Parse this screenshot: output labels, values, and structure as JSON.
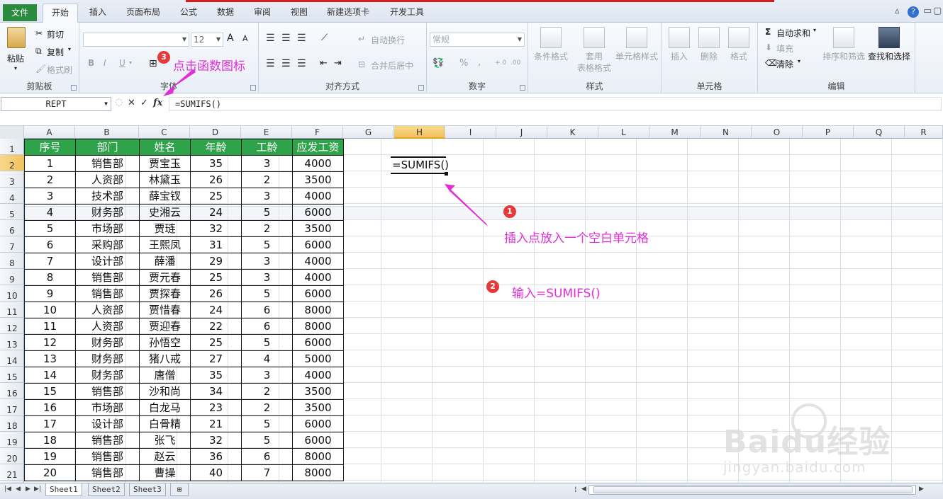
{
  "ribbon": {
    "tabs": [
      "文件",
      "开始",
      "插入",
      "页面布局",
      "公式",
      "数据",
      "审阅",
      "视图",
      "新建选项卡",
      "开发工具"
    ],
    "active_tab": "开始",
    "clipboard": {
      "paste": "粘贴",
      "cut": "剪切",
      "copy": "复制",
      "format_painter": "格式刷",
      "label": "剪贴板"
    },
    "font": {
      "size": "12",
      "bold": "B",
      "italic": "I",
      "underline": "U",
      "grow": "A",
      "shrink": "A",
      "label": "字体"
    },
    "alignment": {
      "wrap": "自动换行",
      "merge": "合并后居中",
      "label": "对齐方式"
    },
    "number": {
      "format": "常规",
      "percent": "%",
      "comma": ",",
      "label": "数字"
    },
    "styles": {
      "conditional": "条件格式",
      "table_format": "套用\n表格格式",
      "cell_styles": "单元格样式",
      "label": "样式"
    },
    "cells": {
      "insert": "插入",
      "delete": "删除",
      "format": "格式",
      "label": "单元格"
    },
    "editing": {
      "autosum": "自动求和",
      "fill": "填充",
      "clear": "清除",
      "sort": "排序和筛选",
      "find": "查找和选择",
      "label": "编辑"
    }
  },
  "formula_bar": {
    "name_box": "REPT",
    "cancel": "✕",
    "enter": "✓",
    "fx": "fx",
    "formula": "=SUMIFS()"
  },
  "grid": {
    "columns": [
      "A",
      "B",
      "C",
      "D",
      "E",
      "F",
      "G",
      "H",
      "I",
      "J",
      "K",
      "L",
      "M",
      "N",
      "O",
      "P",
      "Q",
      "R"
    ],
    "selected_column": "H",
    "rows": [
      "1",
      "2",
      "3",
      "4",
      "5",
      "6",
      "7",
      "8",
      "9",
      "10",
      "11",
      "12",
      "13",
      "14",
      "15",
      "16",
      "17",
      "18",
      "19",
      "20",
      "21"
    ],
    "selected_row": "2",
    "active_cell_value": "=SUMIFS()"
  },
  "table": {
    "headers": [
      "序号",
      "部门",
      "姓名",
      "年龄",
      "工龄",
      "应发工资"
    ],
    "rows": [
      [
        "1",
        "销售部",
        "贾宝玉",
        "35",
        "3",
        "4000"
      ],
      [
        "2",
        "人资部",
        "林黛玉",
        "26",
        "2",
        "3500"
      ],
      [
        "3",
        "技术部",
        "薛宝钗",
        "25",
        "3",
        "4000"
      ],
      [
        "4",
        "财务部",
        "史湘云",
        "24",
        "5",
        "6000"
      ],
      [
        "5",
        "市场部",
        "贾琏",
        "32",
        "2",
        "3500"
      ],
      [
        "6",
        "采购部",
        "王熙凤",
        "31",
        "5",
        "6000"
      ],
      [
        "7",
        "设计部",
        "薛潘",
        "29",
        "3",
        "4000"
      ],
      [
        "8",
        "销售部",
        "贾元春",
        "25",
        "3",
        "4000"
      ],
      [
        "9",
        "销售部",
        "贾探春",
        "26",
        "5",
        "6000"
      ],
      [
        "10",
        "人资部",
        "贾惜春",
        "24",
        "6",
        "8000"
      ],
      [
        "11",
        "人资部",
        "贾迎春",
        "22",
        "6",
        "8000"
      ],
      [
        "12",
        "财务部",
        "孙悟空",
        "25",
        "5",
        "6000"
      ],
      [
        "13",
        "财务部",
        "猪八戒",
        "27",
        "4",
        "5000"
      ],
      [
        "14",
        "财务部",
        "唐僧",
        "35",
        "3",
        "4000"
      ],
      [
        "15",
        "销售部",
        "沙和尚",
        "34",
        "2",
        "3500"
      ],
      [
        "16",
        "市场部",
        "白龙马",
        "23",
        "2",
        "3500"
      ],
      [
        "17",
        "设计部",
        "白骨精",
        "21",
        "5",
        "6000"
      ],
      [
        "18",
        "销售部",
        "张飞",
        "32",
        "5",
        "6000"
      ],
      [
        "19",
        "销售部",
        "赵云",
        "36",
        "6",
        "8000"
      ],
      [
        "20",
        "销售部",
        "曹操",
        "40",
        "7",
        "8000"
      ]
    ]
  },
  "annotations": {
    "step1": {
      "num": "1",
      "text": "插入点放入一个空白单元格"
    },
    "step2": {
      "num": "2",
      "text": "输入=SUMIFS()"
    },
    "step3": {
      "num": "3",
      "text": "点击函数图标"
    }
  },
  "sheets": [
    "Sheet1",
    "Sheet2",
    "Sheet3"
  ],
  "active_sheet": "Sheet1",
  "watermark": {
    "brand": "Baidu经验",
    "url": "jingyan.baidu.com"
  },
  "colors": {
    "header_fill": "#2ea34a",
    "annotation": "#e22ed6",
    "badge": "#e53a3a",
    "file_tab": "#2a8a3e"
  }
}
